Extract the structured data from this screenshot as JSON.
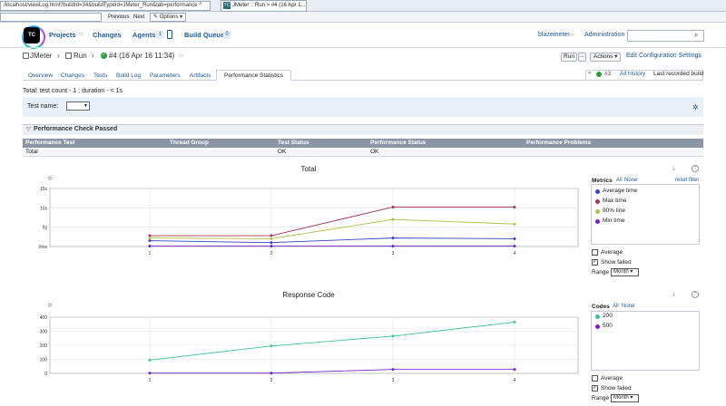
{
  "browser": {
    "url": "/localhost/viewLog.html?buildId=34&buildTypeId=JMeter_Run&tab=performance",
    "tab_other": "",
    "tab_active": "JMeter :: Run > #4 (16 Apr 1..."
  },
  "findbar": {
    "previous": "Previous",
    "next": "Next",
    "options": "Options"
  },
  "header": {
    "logo": "TC",
    "projects": "Projects",
    "changes": "Changes",
    "agents": "Agents",
    "agents_count": "1",
    "build_queue": "Build Queue",
    "queue_count": "0",
    "user": "blazemeter",
    "administration": "Administration"
  },
  "breadcrumb": {
    "project": "JMeter",
    "config": "Run",
    "build": "#4 (16 Apr 16 11:34)"
  },
  "actions": {
    "run": "Run",
    "run_more": "...",
    "actions": "Actions",
    "edit_config": "Edit Configuration Settings"
  },
  "tabs": [
    "Overview",
    "Changes",
    "Tests",
    "Build Log",
    "Parameters",
    "Artifacts"
  ],
  "active_tab": "Performance Statistics",
  "history": {
    "build_num": "#3",
    "all_history": "All history",
    "last_recorded": "Last recorded build"
  },
  "summary": "Total: test count - 1 ; duration - < 1s",
  "test_name": {
    "label": "Test name:"
  },
  "check_panel": {
    "title": "Performance Check Passed",
    "columns": [
      "Performance Test",
      "Thread Group",
      "Test Status",
      "Performance Status",
      "Performance Problems"
    ],
    "row": [
      "Total",
      "",
      "OK",
      "OK",
      ""
    ]
  },
  "colors": {
    "avg": "#3a43c4",
    "max": "#a3334f",
    "line90": "#b6c148",
    "min": "#7a1fc9",
    "c200": "#3ec39b",
    "c500": "#7a1fc9"
  },
  "chart_data": [
    {
      "type": "line",
      "title": "Total",
      "x": [
        1,
        2,
        3,
        4
      ],
      "y_ticks": [
        "0ms",
        "5s",
        "10s",
        "15s"
      ],
      "ylim": [
        0,
        15
      ],
      "grid": true,
      "legend_title": "Metrics",
      "legend_all": "All",
      "legend_none": "None",
      "reset_filter": "reset filter",
      "series": [
        {
          "name": "Average time",
          "values": [
            1.5,
            1.0,
            2.2,
            2.0
          ]
        },
        {
          "name": "Max time",
          "values": [
            2.8,
            2.8,
            10.2,
            10.2
          ]
        },
        {
          "name": "90% line",
          "values": [
            2.2,
            2.0,
            7.0,
            5.8
          ]
        },
        {
          "name": "Min time",
          "values": [
            0.1,
            0.1,
            0.1,
            0.1
          ]
        }
      ],
      "average_label": "Average",
      "show_failed_label": "Show failed",
      "range_label": "Range",
      "range_value": "Month"
    },
    {
      "type": "line",
      "title": "Response Code",
      "x": [
        1,
        2,
        3,
        4
      ],
      "y_ticks": [
        "0",
        "100",
        "200",
        "300",
        "400"
      ],
      "ylim": [
        0,
        400
      ],
      "grid": true,
      "legend_title": "Codes",
      "legend_all": "All",
      "legend_none": "None",
      "series": [
        {
          "name": "200",
          "values": [
            95,
            195,
            265,
            365
          ]
        },
        {
          "name": "500",
          "values": [
            2,
            2,
            28,
            28
          ]
        }
      ],
      "average_label": "Average",
      "show_failed_label": "Show failed",
      "range_label": "Range",
      "range_value": "Month"
    }
  ]
}
